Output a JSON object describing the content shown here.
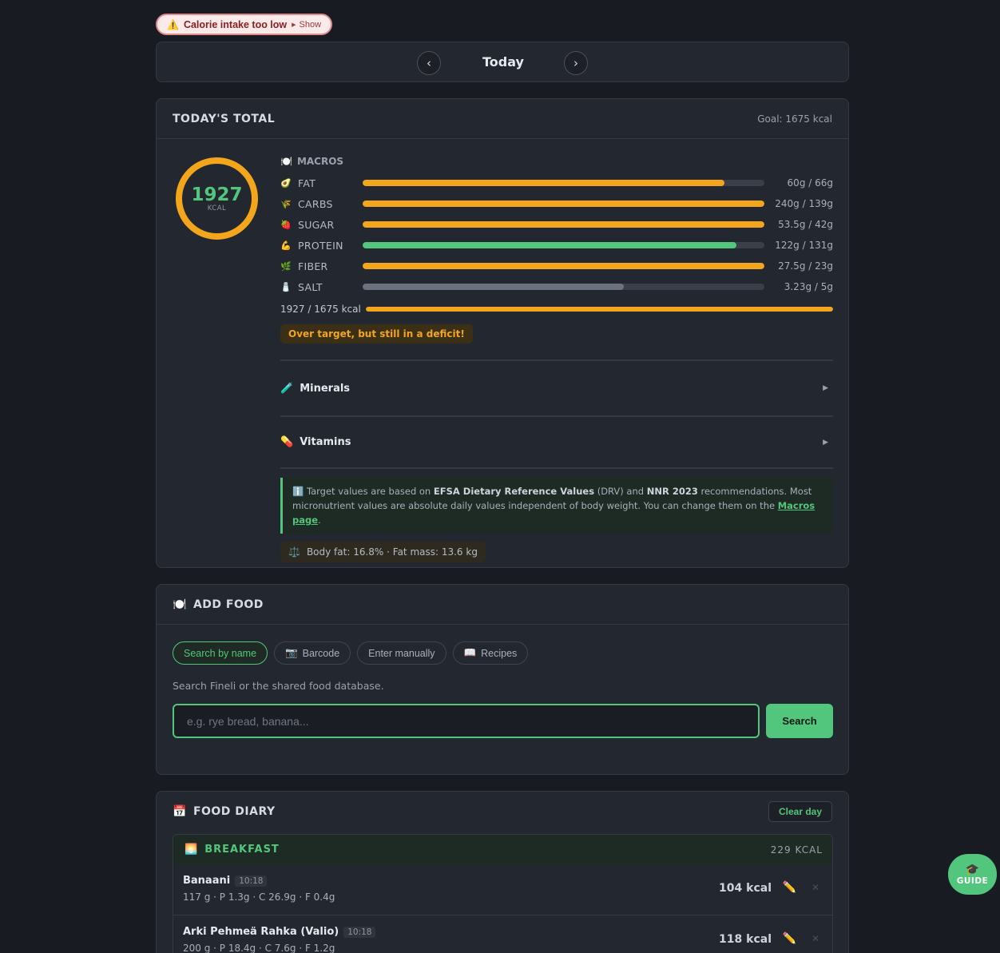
{
  "alert": {
    "icon": "⚠️",
    "label": "Calorie intake too low",
    "show": "Show"
  },
  "datenav": {
    "prev": "‹",
    "title": "Today",
    "next": "›"
  },
  "total": {
    "title": "TODAY'S TOTAL",
    "goal": "Goal: 1675 kcal",
    "kcal_value": "1927",
    "kcal_unit": "KCAL",
    "macros_title": "MACROS",
    "macros": [
      {
        "icon": "🥑",
        "label": "FAT",
        "value": "60g / 66g",
        "fill_pct": 90,
        "color": "#f3a51b"
      },
      {
        "icon": "🌾",
        "label": "CARBS",
        "value": "240g / 139g",
        "fill_pct": 100,
        "color": "#f3a51b"
      },
      {
        "icon": "🍓",
        "label": "SUGAR",
        "value": "53.5g / 42g",
        "fill_pct": 100,
        "color": "#f3a51b"
      },
      {
        "icon": "💪",
        "label": "PROTEIN",
        "value": "122g / 131g",
        "fill_pct": 93,
        "color": "#52c67c"
      },
      {
        "icon": "🌿",
        "label": "FIBER",
        "value": "27.5g / 23g",
        "fill_pct": 100,
        "color": "#f3a51b"
      },
      {
        "icon": "🧂",
        "label": "SALT",
        "value": "3.23g / 5g",
        "fill_pct": 65,
        "color": "#6b717d"
      }
    ],
    "kcal_progress": {
      "label": "1927 / 1675 kcal",
      "fill_pct": 100,
      "color": "#f3a51b"
    },
    "deficit_msg": "Over target, but still in a deficit!",
    "minerals": {
      "icon": "🧪",
      "label": "Minerals",
      "arrow": "▶"
    },
    "vitamins": {
      "icon": "💊",
      "label": "Vitamins",
      "arrow": "▶"
    },
    "info": {
      "icon": "ℹ️",
      "t1": "Target values are based on ",
      "b1": "EFSA Dietary Reference Values",
      "t2": " (DRV) and ",
      "b2": "NNR 2023",
      "t3": " recommendations. Most micronutrient values are absolute daily values independent of body weight. You can change them on the ",
      "link": "Macros page",
      "t4": "."
    },
    "bodyfat": {
      "icon": "⚖️",
      "text": "Body fat: 16.8% · Fat mass: 13.6 kg"
    }
  },
  "addfood": {
    "icon": "🍽️",
    "title": "ADD FOOD",
    "tabs": [
      {
        "icon": "",
        "label": "Search by name"
      },
      {
        "icon": "📷",
        "label": "Barcode"
      },
      {
        "icon": "",
        "label": "Enter manually"
      },
      {
        "icon": "📖",
        "label": "Recipes"
      }
    ],
    "hint": "Search Fineli or the shared food database.",
    "search_placeholder": "e.g. rye bread, banana...",
    "search_button": "Search"
  },
  "diary": {
    "icon": "📅",
    "title": "FOOD DIARY",
    "clear": "Clear day",
    "meal": {
      "icon": "🌅",
      "title": "BREAKFAST",
      "kcal": "229 KCAL"
    },
    "entries": [
      {
        "name": "Banaani",
        "time": "10:18",
        "details": "117 g  ·  P 1.3g  ·  C 26.9g  ·  F 0.4g",
        "kcal": "104 kcal"
      },
      {
        "name": "Arki Pehmeä Rahka (Valio)",
        "time": "10:18",
        "details": "200 g  ·  P 18.4g  ·  C 7.6g  ·  F 1.2g",
        "kcal": "118 kcal"
      }
    ],
    "edit_icon": "✏️",
    "delete_icon": "✕"
  },
  "guide": {
    "icon": "🎓",
    "label": "GUIDE"
  }
}
